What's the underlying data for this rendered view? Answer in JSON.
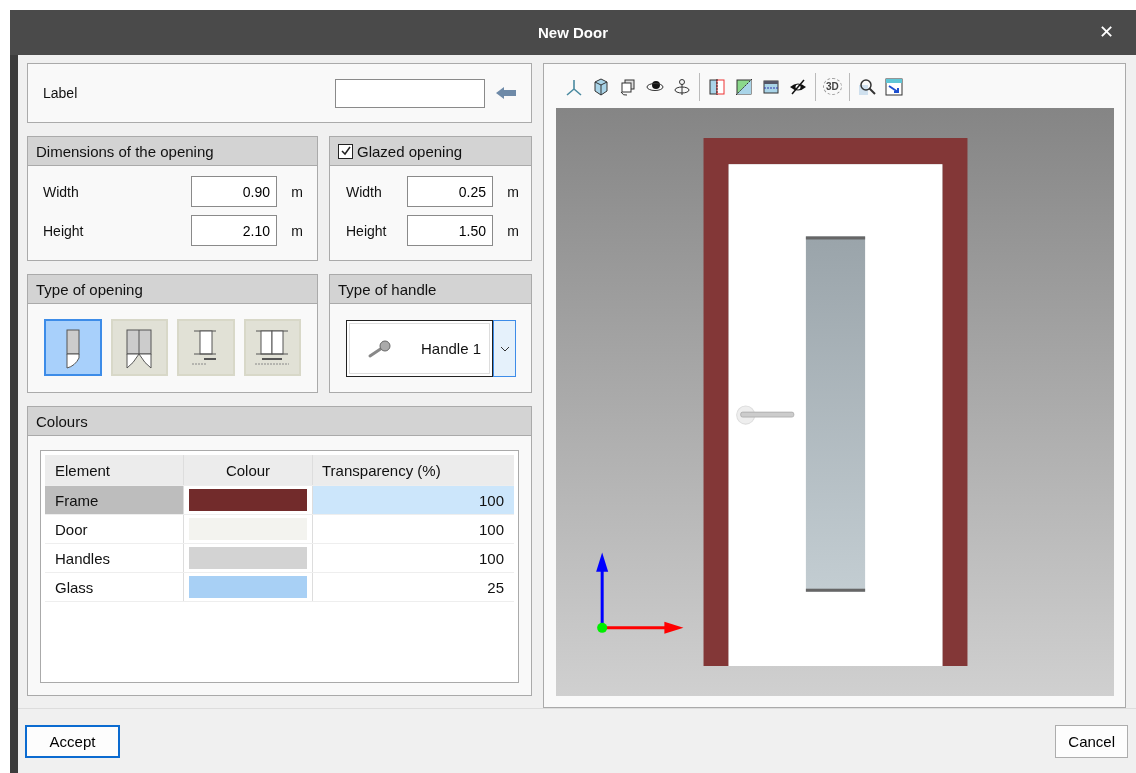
{
  "window": {
    "title": "New Door",
    "close": "✕"
  },
  "label": {
    "text": "Label"
  },
  "dimensions": {
    "title": "Dimensions of the opening",
    "fields": [
      {
        "label": "Width",
        "value": "0.90",
        "unit": "m"
      },
      {
        "label": "Height",
        "value": "2.10",
        "unit": "m"
      }
    ]
  },
  "glazed": {
    "title": "Glazed opening",
    "checked": true,
    "fields": [
      {
        "label": "Width",
        "value": "0.25",
        "unit": "m"
      },
      {
        "label": "Height",
        "value": "1.50",
        "unit": "m"
      }
    ]
  },
  "opening_types": {
    "title": "Type of opening",
    "items": [
      {
        "kind": "single",
        "selected": true
      },
      {
        "kind": "double",
        "selected": false
      },
      {
        "kind": "sliding",
        "selected": false
      },
      {
        "kind": "double-sliding",
        "selected": false
      }
    ]
  },
  "handle": {
    "title": "Type of handle",
    "value": "Handle 1"
  },
  "colours": {
    "title": "Colours",
    "columns": [
      "Element",
      "Colour",
      "Transparency (%)"
    ],
    "rows": [
      {
        "element": "Frame",
        "color": "#722b2b",
        "transparency": "100",
        "selected": true
      },
      {
        "element": "Door",
        "color": "#f3f3ef",
        "transparency": "100",
        "selected": false
      },
      {
        "element": "Handles",
        "color": "#d3d3d3",
        "transparency": "100",
        "selected": false
      },
      {
        "element": "Glass",
        "color": "#a8d0f5",
        "transparency": "25",
        "selected": false
      }
    ]
  },
  "toolbar": {
    "render_label": "3D"
  },
  "buttons": {
    "accept": "Accept",
    "cancel": "Cancel"
  }
}
